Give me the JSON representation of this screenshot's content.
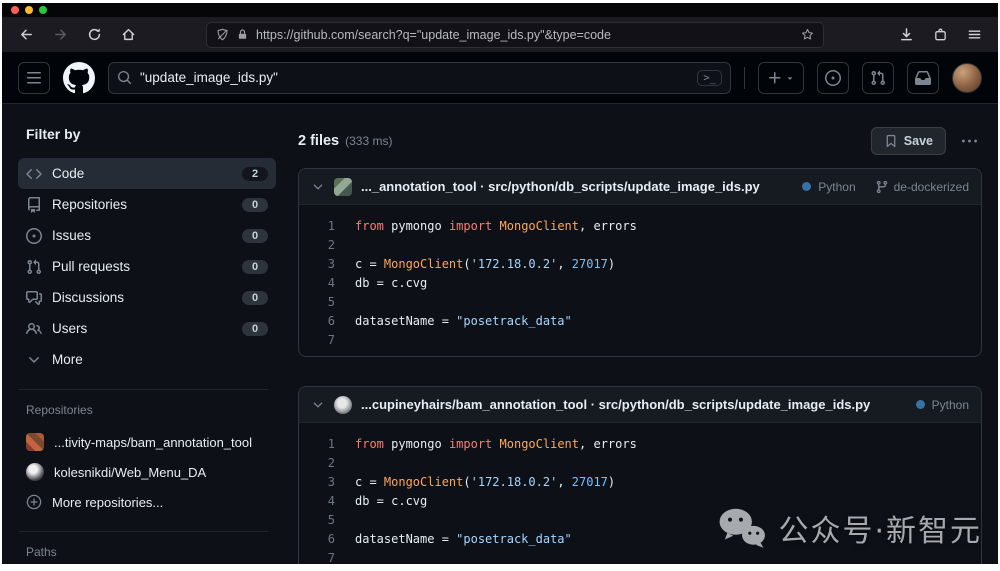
{
  "browser": {
    "url": "https://github.com/search?q=\"update_image_ids.py\"&type=code"
  },
  "github": {
    "search_value": "\"update_image_ids.py\"",
    "command_hint": ">_"
  },
  "sidebar": {
    "title": "Filter by",
    "items": [
      {
        "label": "Code",
        "count": "2"
      },
      {
        "label": "Repositories",
        "count": "0"
      },
      {
        "label": "Issues",
        "count": "0"
      },
      {
        "label": "Pull requests",
        "count": "0"
      },
      {
        "label": "Discussions",
        "count": "0"
      },
      {
        "label": "Users",
        "count": "0"
      }
    ],
    "more_label": "More",
    "repositories_title": "Repositories",
    "repositories": [
      {
        "name": "...tivity-maps/bam_annotation_tool"
      },
      {
        "name": "kolesnikdi/Web_Menu_DA"
      }
    ],
    "more_repositories_label": "More repositories...",
    "paths_title": "Paths"
  },
  "results": {
    "files_label": "2 files",
    "time_label": "(333 ms)",
    "save_label": "Save",
    "language_color": "#3572A5",
    "cards": [
      {
        "title": "..._annotation_tool · src/python/db_scripts/update_image_ids.py",
        "language": "Python",
        "branch": "de-dockerized"
      },
      {
        "title": "...cupineyhairs/bam_annotation_tool · src/python/db_scripts/update_image_ids.py",
        "language": "Python"
      }
    ]
  },
  "code_lines": [
    {
      "n": "1",
      "tokens": [
        {
          "t": "from",
          "c": "k"
        },
        {
          "t": " pymongo ",
          "c": "p"
        },
        {
          "t": "import",
          "c": "k"
        },
        {
          "t": " ",
          "c": "p"
        },
        {
          "t": "MongoClient",
          "c": "e"
        },
        {
          "t": ", errors",
          "c": "p"
        }
      ]
    },
    {
      "n": "2",
      "tokens": []
    },
    {
      "n": "3",
      "tokens": [
        {
          "t": "c = ",
          "c": "p"
        },
        {
          "t": "MongoClient",
          "c": "e"
        },
        {
          "t": "(",
          "c": "p"
        },
        {
          "t": "'172.18.0.2'",
          "c": "s"
        },
        {
          "t": ", ",
          "c": "p"
        },
        {
          "t": "27017",
          "c": "n"
        },
        {
          "t": ")",
          "c": "p"
        }
      ]
    },
    {
      "n": "4",
      "tokens": [
        {
          "t": "db = c.cvg",
          "c": "p"
        }
      ]
    },
    {
      "n": "5",
      "tokens": []
    },
    {
      "n": "6",
      "tokens": [
        {
          "t": "datasetName = ",
          "c": "p"
        },
        {
          "t": "\"posetrack_data\"",
          "c": "s"
        }
      ]
    },
    {
      "n": "7",
      "tokens": []
    }
  ],
  "watermark": {
    "text": "公众号·新智元"
  }
}
